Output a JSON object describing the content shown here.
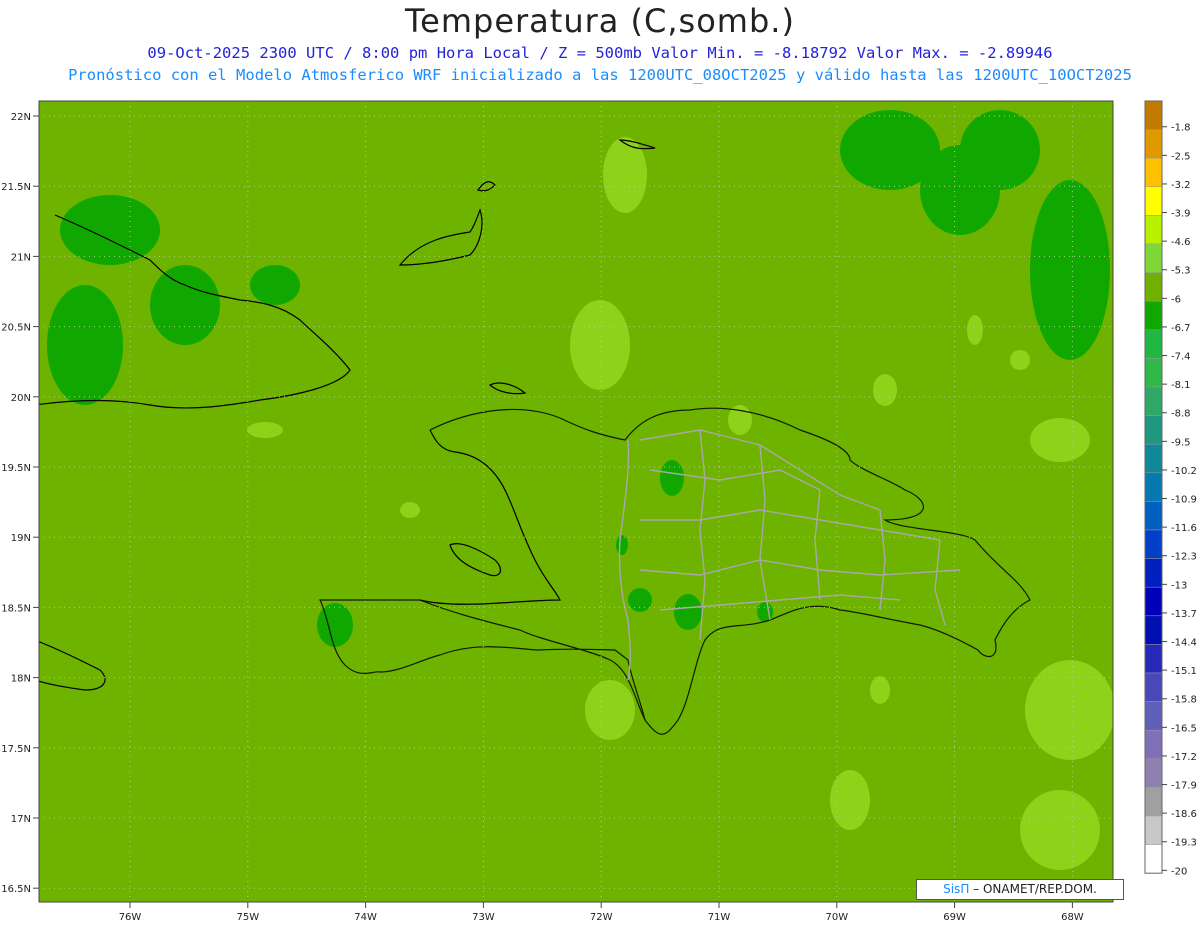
{
  "header": {
    "title": "Temperatura (C,somb.)",
    "line1": "09-Oct-2025  2300 UTC / 8:00 pm Hora Local / Z = 500mb  Valor Min. = -8.18792  Valor Max. = -2.89946",
    "line2": "Pronóstico con el Modelo Atmosferico WRF inicializado a las 1200UTC_08OCT2025 y válido hasta las  1200UTC_10OCT2025"
  },
  "axes": {
    "lat_labels": [
      "22N",
      "21.5N",
      "21N",
      "20.5N",
      "20N",
      "19.5N",
      "19N",
      "18.5N",
      "18N",
      "17.5N",
      "17N",
      "16.5N"
    ],
    "lon_labels": [
      "76W",
      "75W",
      "74W",
      "73W",
      "72W",
      "71W",
      "70W",
      "69W",
      "68W"
    ]
  },
  "colorbar": {
    "labels": [
      "-1.8",
      "-2.5",
      "-3.2",
      "-3.9",
      "-4.6",
      "-5.3",
      "-6",
      "-6.7",
      "-7.4",
      "-8.1",
      "-8.8",
      "-9.5",
      "-10.2",
      "-10.9",
      "-11.6",
      "-12.3",
      "-13",
      "-13.7",
      "-14.4",
      "-15.1",
      "-15.8",
      "-16.5",
      "-17.2",
      "-17.9",
      "-18.6",
      "-19.3",
      "-20"
    ],
    "colors": [
      "#c07c00",
      "#e09a00",
      "#ffc000",
      "#ffff00",
      "#b8f000",
      "#80d838",
      "#70b000",
      "#10a800",
      "#20b840",
      "#30b848",
      "#30a868",
      "#209880",
      "#108898",
      "#0878b0",
      "#0060c0",
      "#0040c8",
      "#0020c0",
      "#0000b8",
      "#0010b0",
      "#2828b8",
      "#4848b8",
      "#6060b8",
      "#8070b8",
      "#9080b0",
      "#a0a0a0",
      "#c8c8c8",
      "#ffffff"
    ]
  },
  "map": {
    "background_color": "#6eb300",
    "warm_patch_color": "#8ed21a",
    "cool_patch_color": "#10a800",
    "coast_color": "#000000",
    "border_color": "#a8a8a8"
  },
  "credit": {
    "brand": "SisΠ",
    "text": " – ONAMET/REP.DOM."
  }
}
